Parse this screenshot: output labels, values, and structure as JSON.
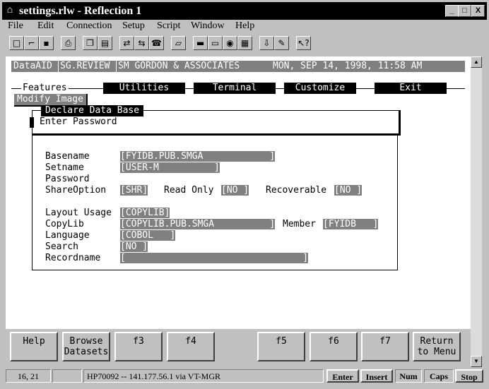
{
  "window": {
    "title": "settings.rlw - Reflection 1",
    "minimize": "_",
    "maximize": "□",
    "close": "X"
  },
  "menu": [
    "File",
    "Edit",
    "Connection",
    "Setup",
    "Script",
    "Window",
    "Help"
  ],
  "toolbar_icons": [
    "new-icon",
    "open-icon",
    "save-icon",
    "print-icon",
    "copy-icon",
    "paste-icon",
    "connect-icon",
    "disconnect-icon",
    "dial-icon",
    "keyboard-map-icon",
    "terminal-icon",
    "display-setup-icon",
    "color-icon",
    "keyboard-icon",
    "transfer-icon",
    "script-icon",
    "context-help-icon"
  ],
  "terminal": {
    "header": {
      "app": "DataAID",
      "module": "SG.REVIEW",
      "company": "SM GORDON & ASSOCIATES",
      "datetime": "MON, SEP 14, 1998, 11:58 AM"
    },
    "tabs": {
      "features": "Features",
      "utilities": "Utilities",
      "terminal": "Terminal",
      "customize": "Customize",
      "exit": "Exit"
    },
    "submenu": "Modify Image",
    "dialog": {
      "title": "Declare Data Base",
      "prompt": "Enter Password"
    },
    "form": {
      "basename_label": "Basename",
      "basename_value": "[FYIDB.PUB.SMGA            ]",
      "setname_label": "Setname",
      "setname_value": "[USER-M          ]",
      "password_label": "Password",
      "shareoption_label": "ShareOption",
      "shareoption_value": "[SHR]",
      "readonly_label": "Read Only",
      "readonly_value": "[NO ]",
      "recoverable_label": "Recoverable",
      "recoverable_value": "[NO ]",
      "layout_label": "Layout Usage",
      "layout_value": "[COPYLIB]",
      "copylib_label": "CopyLib",
      "copylib_value": "[COPYLIB.PUB.SMGA          ]",
      "member_label": "Member",
      "member_value": "[FYIDB   ]",
      "language_label": "Language",
      "language_value": "[COBOL   ]",
      "search_label": "Search",
      "search_value": "[NO ]",
      "recordname_label": "Recordname",
      "recordname_value": "[                                ]"
    }
  },
  "function_keys": {
    "f1": "Help",
    "f2_line1": "Browse",
    "f2_line2": "Datasets",
    "f3": "f3",
    "f4": "f4",
    "f5": "f5",
    "f6": "f6",
    "f7": "f7",
    "f8_line1": "Return",
    "f8_line2": "to Menu"
  },
  "status": {
    "cursor": "16, 21",
    "connection": "HP70092 -- 141.177.56.1 via VT-MGR",
    "enter": "Enter",
    "insert": "Insert",
    "num": "Num",
    "caps": "Caps",
    "stop": "Stop"
  }
}
